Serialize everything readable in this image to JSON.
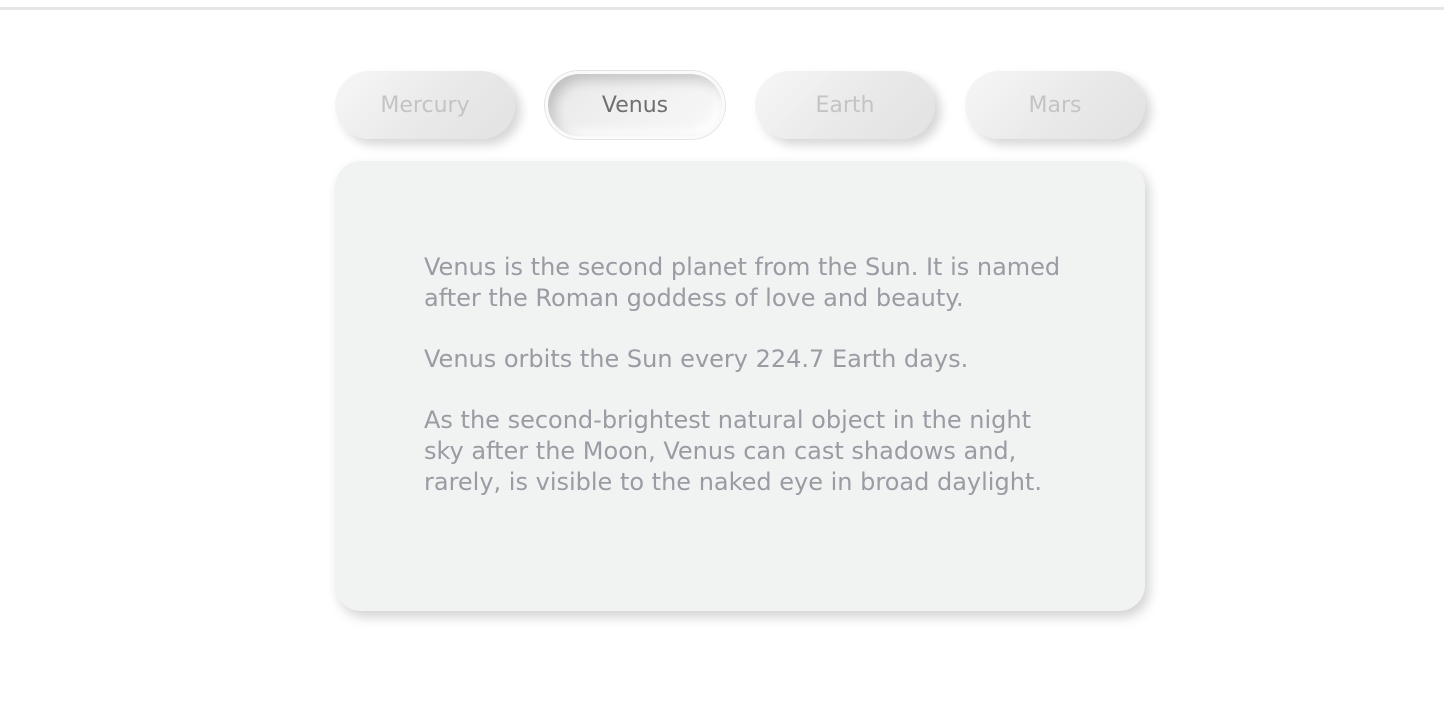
{
  "tabs": [
    {
      "label": "Mercury",
      "active": false
    },
    {
      "label": "Venus",
      "active": true
    },
    {
      "label": "Earth",
      "active": false
    },
    {
      "label": "Mars",
      "active": false
    }
  ],
  "panel": {
    "paragraphs": [
      "Venus is the second planet from the Sun. It is named after the Roman goddess of love and beauty.",
      "Venus orbits the Sun every 224.7 Earth days.",
      "As the second-brightest natural object in the night sky after the Moon, Venus can cast shadows and, rarely, is visible to the naked eye in broad daylight."
    ]
  }
}
